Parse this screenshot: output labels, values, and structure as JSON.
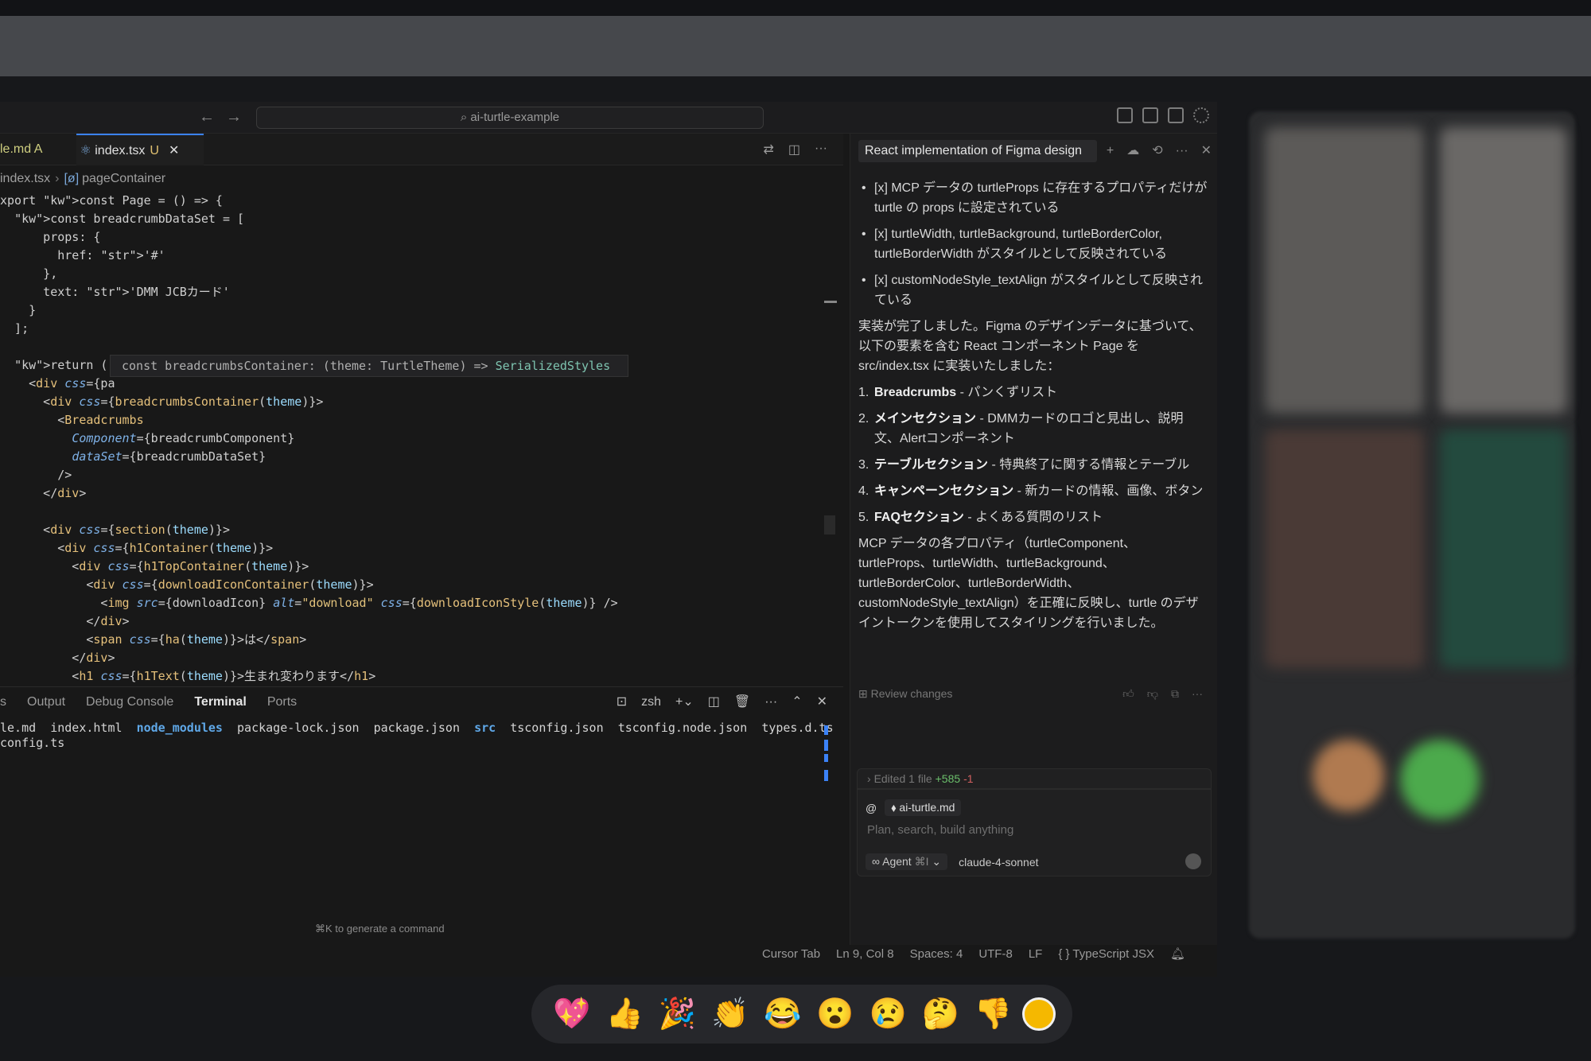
{
  "search": {
    "placeholder": "ai-turtle-example"
  },
  "tabs": [
    {
      "label": "le.md",
      "badge": "A"
    },
    {
      "label": "index.tsx",
      "badge": "U"
    }
  ],
  "breadcrumb": {
    "file": "index.tsx",
    "symbol": "pageContainer"
  },
  "hover_tooltip": {
    "name": "const breadcrumbsContainer:",
    "param": "(theme: TurtleTheme) => ",
    "type": "SerializedStyles"
  },
  "code_lines": [
    "xport const Page = () => {",
    "  const breadcrumbDataSet = [",
    "      props: {",
    "        href: '#'",
    "      },",
    "      text: 'DMM JCBカード'",
    "    }",
    "  ];",
    "",
    "  return (",
    "    <div css={pa",
    "      <div css={breadcrumbsContainer(theme)}>",
    "        <Breadcrumbs",
    "          Component={breadcrumbComponent}",
    "          dataSet={breadcrumbDataSet}",
    "        />",
    "      </div>",
    "",
    "      <div css={section(theme)}>",
    "        <div css={h1Container(theme)}>",
    "          <div css={h1TopContainer(theme)}>",
    "            <div css={downloadIconContainer(theme)}>",
    "              <img src={downloadIcon} alt=\"download\" css={downloadIconStyle(theme)} />",
    "            </div>",
    "            <span css={ha(theme)}>は</span>",
    "          </div>",
    "          <h1 css={h1Text(theme)}>生まれ変わります</h1>",
    "        </div>"
  ],
  "panel": {
    "tabs": [
      "s",
      "Output",
      "Debug Console",
      "Terminal",
      "Ports"
    ],
    "active_tab": "Terminal",
    "shell": "zsh",
    "terminal_line1": [
      "le.md",
      "index.html",
      "node_modules",
      "package-lock.json",
      "package.json",
      "src",
      "tsconfig.json",
      "tsconfig.node.json",
      "types.d.ts"
    ],
    "terminal_line2": "config.ts",
    "hint": "⌘K to generate a command"
  },
  "chat": {
    "title": "React implementation of Figma design",
    "bullets": [
      "[x] MCP データの turtleProps に存在するプロパティだけが turtle の props に設定されている",
      "[x] turtleWidth, turtleBackground, turtleBorderColor, turtleBorderWidth がスタイルとして反映されている",
      "[x] customNodeStyle_textAlign がスタイルとして反映されている"
    ],
    "summary": "実装が完了しました。Figma のデザインデータに基づいて、以下の要素を含む React コンポーネント Page を src/index.tsx に実装いたしました：",
    "list": [
      {
        "n": "1.",
        "title": "Breadcrumbs",
        "desc": " - パンくずリスト"
      },
      {
        "n": "2.",
        "title": "メインセクション",
        "desc": " - DMMカードのロゴと見出し、説明文、Alertコンポーネント"
      },
      {
        "n": "3.",
        "title": "テーブルセクション",
        "desc": " - 特典終了に関する情報とテーブル"
      },
      {
        "n": "4.",
        "title": "キャンペーンセクション",
        "desc": " - 新カードの情報、画像、ボタン"
      },
      {
        "n": "5.",
        "title": "FAQセクション",
        "desc": " - よくある質問のリスト"
      }
    ],
    "closing": "MCP データの各プロパティ（turtleComponent、turtleProps、turtleWidth、turtleBackground、turtleBorderColor、turtleBorderWidth、customNodeStyle_textAlign）を正確に反映し、turtle のデザイントークンを使用してスタイリングを行いました。",
    "review_label": "Review changes",
    "edited": {
      "label": "Edited 1 file",
      "plus": "+585",
      "minus": "-1"
    },
    "context_chip": "ai-turtle.md",
    "input_placeholder": "Plan, search, build anything",
    "agent_label": "Agent",
    "agent_shortcut": "⌘I",
    "model": "claude-4-sonnet"
  },
  "status": [
    "Cursor Tab",
    "Ln 9, Col 8",
    "Spaces: 4",
    "UTF-8",
    "LF",
    "{ } TypeScript JSX"
  ],
  "reactions": [
    "💖",
    "👍",
    "🎉",
    "👏",
    "😂",
    "😮",
    "😢",
    "🤔",
    "👎"
  ]
}
